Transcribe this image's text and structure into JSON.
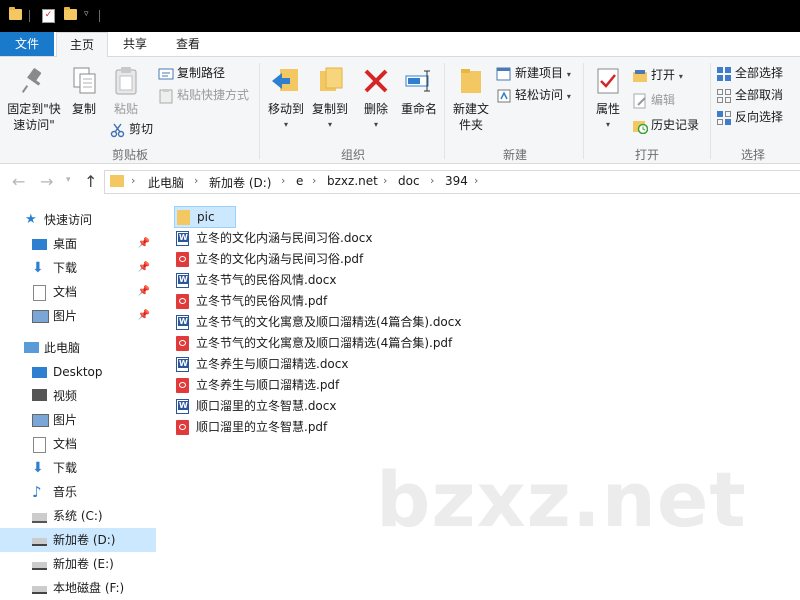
{
  "ribbon_tabs": {
    "file": "文件",
    "home": "主页",
    "share": "共享",
    "view": "查看"
  },
  "clipboard": {
    "pin": "固定到\"快速访问\"",
    "copy": "复制",
    "paste": "粘贴",
    "copy_path": "复制路径",
    "paste_shortcut": "粘贴快捷方式",
    "cut": "剪切",
    "group": "剪贴板"
  },
  "organize": {
    "move_to": "移动到",
    "copy_to": "复制到",
    "delete": "删除",
    "rename": "重命名",
    "group": "组织"
  },
  "new": {
    "new_folder": "新建文件夹",
    "new_item": "新建项目",
    "easy_access": "轻松访问",
    "group": "新建"
  },
  "open": {
    "properties": "属性",
    "open": "打开",
    "edit": "编辑",
    "history": "历史记录",
    "group": "打开"
  },
  "select": {
    "select_all": "全部选择",
    "select_none": "全部取消",
    "invert": "反向选择",
    "group": "选择"
  },
  "breadcrumb": [
    "此电脑",
    "新加卷 (D:)",
    "e",
    "bzxz.net",
    "doc",
    "394"
  ],
  "sidebar": {
    "quick_access": "快速访问",
    "quick_items": [
      "桌面",
      "下载",
      "文档",
      "图片"
    ],
    "this_pc": "此电脑",
    "pc_items": [
      "Desktop",
      "视频",
      "图片",
      "文档",
      "下载",
      "音乐",
      "系统 (C:)",
      "新加卷 (D:)",
      "新加卷 (E:)",
      "本地磁盘 (F:)"
    ]
  },
  "files": [
    {
      "name": "pic",
      "type": "folder"
    },
    {
      "name": "立冬的文化内涵与民间习俗.docx",
      "type": "docx"
    },
    {
      "name": "立冬的文化内涵与民间习俗.pdf",
      "type": "pdf"
    },
    {
      "name": "立冬节气的民俗风情.docx",
      "type": "docx"
    },
    {
      "name": "立冬节气的民俗风情.pdf",
      "type": "pdf"
    },
    {
      "name": "立冬节气的文化寓意及顺口溜精选(4篇合集).docx",
      "type": "docx"
    },
    {
      "name": "立冬节气的文化寓意及顺口溜精选(4篇合集).pdf",
      "type": "pdf"
    },
    {
      "name": "立冬养生与顺口溜精选.docx",
      "type": "docx"
    },
    {
      "name": "立冬养生与顺口溜精选.pdf",
      "type": "pdf"
    },
    {
      "name": "顺口溜里的立冬智慧.docx",
      "type": "docx"
    },
    {
      "name": "顺口溜里的立冬智慧.pdf",
      "type": "pdf"
    }
  ],
  "watermark": "bzxz.net",
  "colors": {
    "accent": "#1979ca",
    "selection": "#cce8ff",
    "folder": "#f3c862",
    "pdf": "#e03a3a",
    "word": "#2b579a"
  }
}
